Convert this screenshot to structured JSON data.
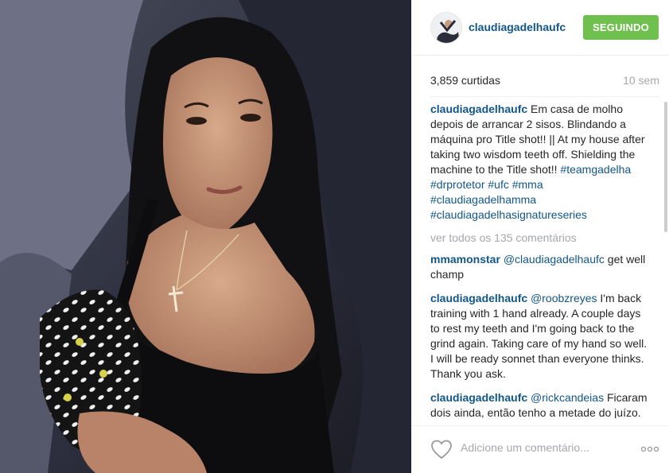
{
  "post": {
    "username": "claudiagadelhaufc",
    "follow_label": "SEGUINDO",
    "likes": "3,859 curtidas",
    "time": "10 sem",
    "caption": {
      "user": "claudiagadelhaufc",
      "text": "Em casa de molho depois de arrancar 2 sisos. Blindando a máquina pro Title shot!! || At my house after taking two wisdom teeth off. Shielding the machine to the Title shot!!",
      "tags": [
        "#teamgadelha",
        "#drprotetor",
        "#ufc",
        "#mma",
        "#claudiagadelhamma",
        "#claudiagadelhasignatureseries"
      ]
    },
    "view_all": "ver todos os 135 comentários",
    "comments": [
      {
        "user": "mmamonstar",
        "mention": "@claudiagadelhaufc",
        "text": "get well champ"
      },
      {
        "user": "claudiagadelhaufc",
        "mention": "@roobzreyes",
        "text": "I'm back training with 1 hand already. A couple days to rest my teeth and I'm going back to the grind again. Taking care of my hand so well. I will be ready sonnet than everyone thinks. Thank you ask."
      },
      {
        "user": "claudiagadelhaufc",
        "mention": "@rickcandeias",
        "text": "Ficaram dois ainda, então tenho a metade do juízo. Hahahaha"
      }
    ],
    "add_comment_placeholder": "Adicione um comentário...",
    "icons": {
      "like": "heart-icon",
      "options": "more-options-icon"
    },
    "colors": {
      "username": "#125688",
      "follow_button": "#70c050",
      "muted": "#a5a7aa"
    }
  }
}
